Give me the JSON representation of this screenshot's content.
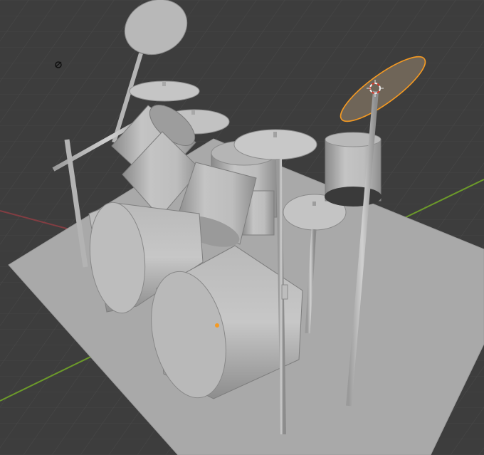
{
  "viewport": {
    "background": "#3d3d3d",
    "grid_color": "#474747",
    "x_axis_color": "#8f3e44",
    "y_axis_color": "#6c9a2a",
    "floor_color": "#aaaaaa",
    "model_color": "#b6b6b6",
    "selection_color": "#f59a22"
  },
  "objects": [
    {
      "name": "floor-plane",
      "selected": false
    },
    {
      "name": "bass-drum",
      "selected": false
    },
    {
      "name": "floor-tom",
      "selected": false
    },
    {
      "name": "rack-tom-left",
      "selected": false
    },
    {
      "name": "rack-tom-right",
      "selected": false
    },
    {
      "name": "snare-drum",
      "selected": false
    },
    {
      "name": "cymbal-crash-selected",
      "selected": true
    },
    {
      "name": "cymbal-ride",
      "selected": false
    },
    {
      "name": "hi-hat",
      "selected": false
    }
  ],
  "icons": {
    "light": "light-icon",
    "cursor_3d": "3d-cursor-icon",
    "origin": "object-origin-icon"
  }
}
